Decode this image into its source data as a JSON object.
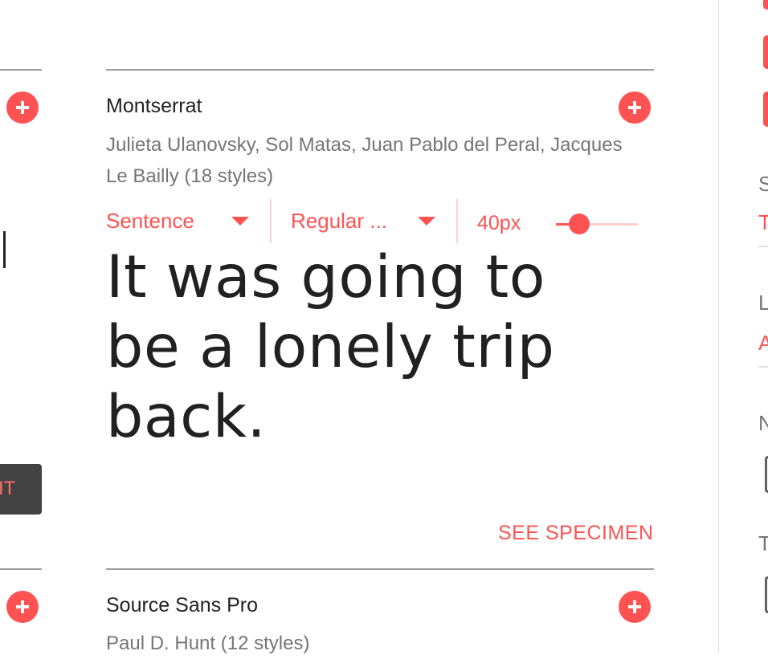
{
  "fonts": [
    {
      "name": "Montserrat",
      "designers": "Julieta Ulanovsky, Sol Matas, Juan Pablo del Peral, Jacques Le Bailly (18 styles)",
      "controls": {
        "sample_type": "Sentence",
        "style": "Regular ...",
        "size": "40px",
        "size_slider_fraction": 0.28
      },
      "preview_text": "It was going to be a lonely trip back.",
      "see_specimen": "SEE SPECIMEN"
    },
    {
      "name": "Source Sans Pro",
      "designers": "Paul D. Hunt (12 styles)"
    }
  ],
  "left_column": {
    "button_partial_text": "IT"
  },
  "right_sidebar": {
    "partial_letters": [
      "S",
      "T",
      "L",
      "A",
      "N",
      "T"
    ]
  },
  "colors": {
    "accent": "#ff5252",
    "text": "#212121",
    "secondary_text": "#757575",
    "dark_button": "#424242"
  },
  "icons": {
    "add": "plus-circle-icon",
    "dropdown": "caret-down-icon"
  }
}
